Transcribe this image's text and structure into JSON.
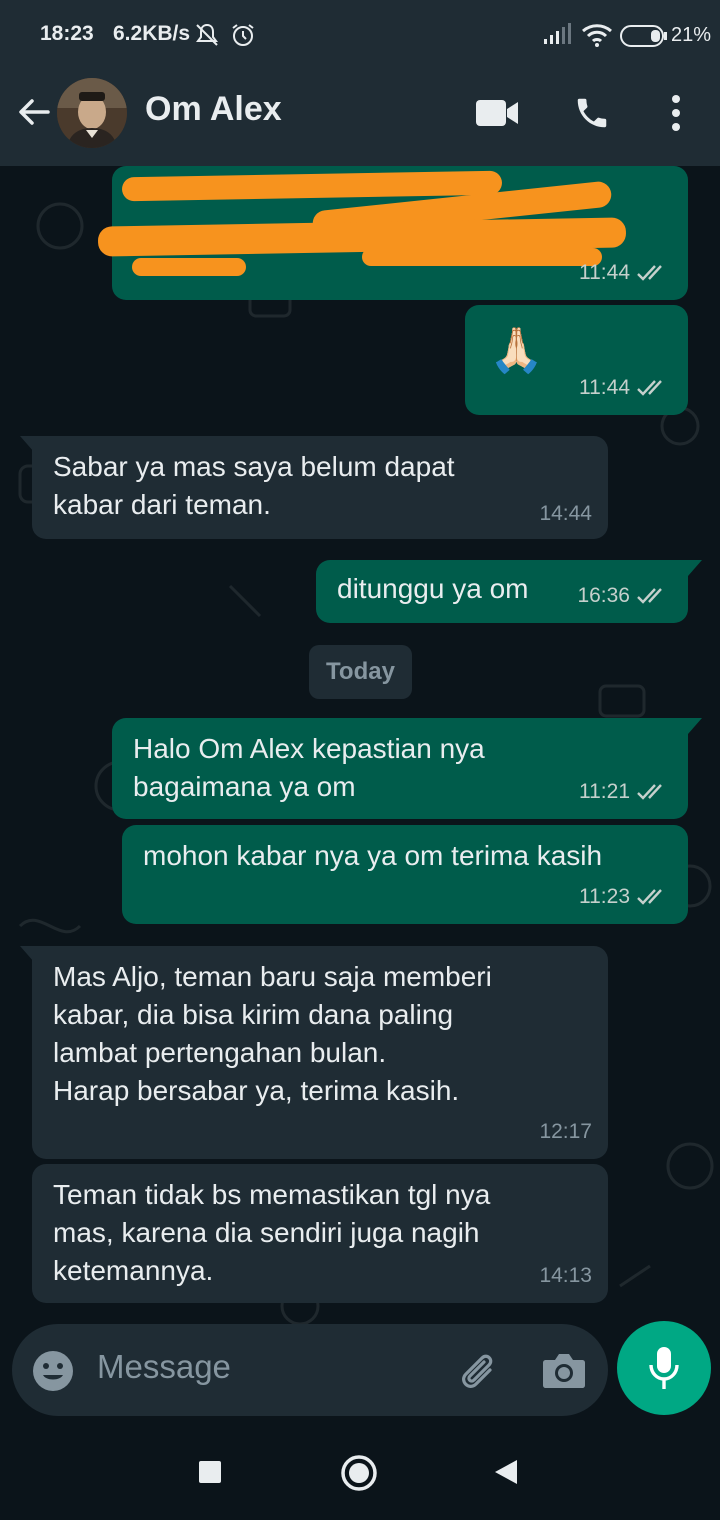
{
  "status_bar": {
    "time": "18:23",
    "net_speed": "6.2KB/s",
    "battery_percent": "21%"
  },
  "header": {
    "contact_name": "Om Alex"
  },
  "messages": [
    {
      "direction": "out",
      "text": "",
      "time": "11:44",
      "redacted": true
    },
    {
      "direction": "out",
      "text": "🙏🏻",
      "time": "11:44"
    },
    {
      "direction": "in",
      "text": "Sabar ya mas saya belum dapat\nkabar dari teman.",
      "time": "14:44"
    },
    {
      "direction": "out",
      "text": "ditunggu ya om",
      "time": "16:36"
    },
    {
      "direction": "out",
      "text": "Halo Om Alex kepastian nya\nbagaimana ya om",
      "time": "11:21"
    },
    {
      "direction": "out",
      "text": "mohon kabar nya ya om terima kasih",
      "time": "11:23"
    },
    {
      "direction": "in",
      "text": "Mas Aljo, teman baru saja memberi\nkabar, dia bisa kirim dana paling\nlambat pertengahan bulan.\nHarap bersabar ya, terima kasih.",
      "time": "12:17"
    },
    {
      "direction": "in",
      "text": "Teman tidak bs memastikan tgl nya\nmas, karena dia sendiri juga nagih\nketemannya.",
      "time": "14:13"
    }
  ],
  "date_divider": "Today",
  "composer": {
    "placeholder": "Message"
  },
  "colors": {
    "outgoing_bubble": "#005c4b",
    "incoming_bubble": "#1f2c34",
    "accent": "#00a884",
    "read_ticks": "#c5d0cc"
  }
}
